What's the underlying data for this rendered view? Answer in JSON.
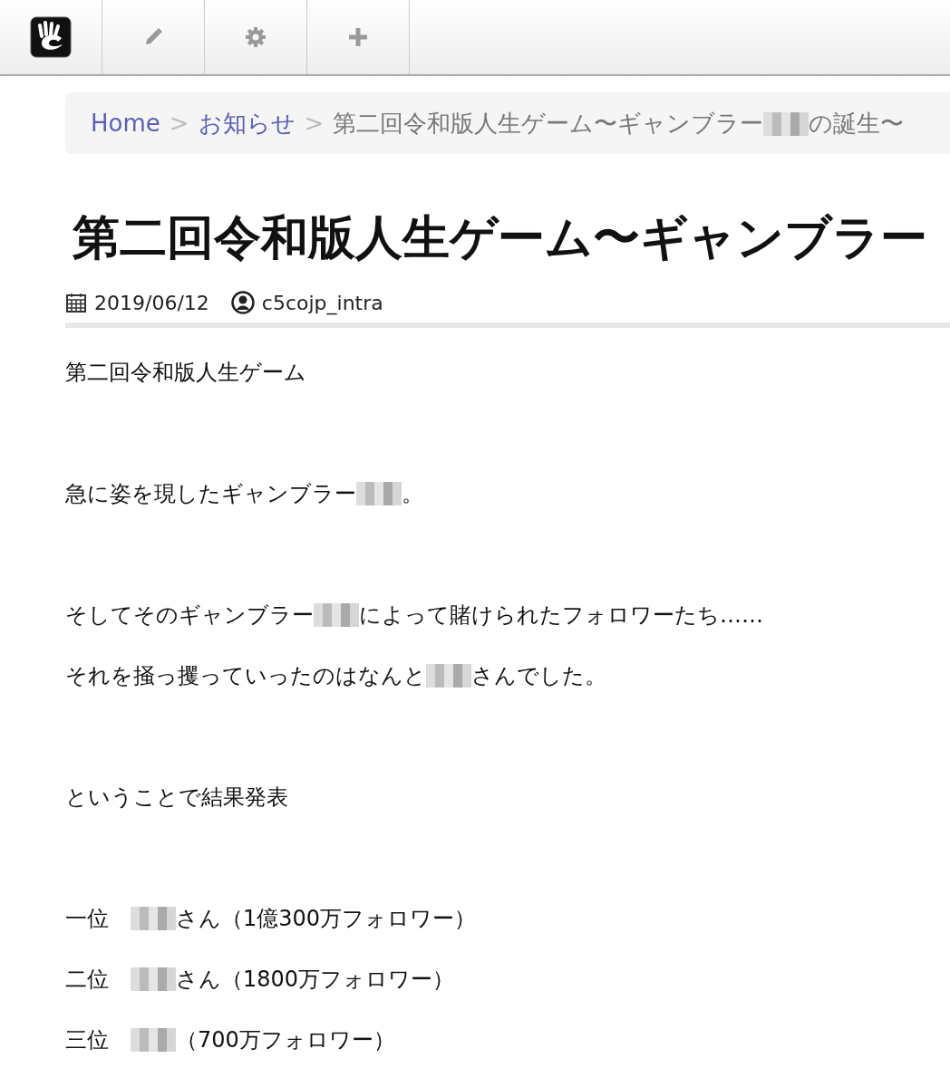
{
  "toolbar": {
    "buttons": [
      {
        "kind": "logo"
      },
      {
        "kind": "edit"
      },
      {
        "kind": "settings"
      },
      {
        "kind": "add"
      }
    ]
  },
  "breadcrumb": [
    {
      "kind": "link",
      "segments": [
        {
          "kind": "text",
          "text": "Home"
        }
      ]
    },
    {
      "kind": "separator",
      "segments": [
        {
          "kind": "text",
          "text": ">"
        }
      ]
    },
    {
      "kind": "link",
      "segments": [
        {
          "kind": "text",
          "text": "お知らせ"
        }
      ]
    },
    {
      "kind": "separator",
      "segments": [
        {
          "kind": "text",
          "text": ">"
        }
      ]
    },
    {
      "kind": "current",
      "segments": [
        {
          "kind": "text",
          "text": "第二回令和版人生ゲーム〜ギャンブラー"
        },
        {
          "kind": "redacted"
        },
        {
          "kind": "text",
          "text": "の誕生〜"
        }
      ]
    }
  ],
  "article": {
    "title": "第二回令和版人生ゲーム〜ギャンブラー",
    "date": "2019/06/12",
    "author": "c5cojp_intra",
    "paragraphs": [
      {
        "kind": "line",
        "segments": [
          {
            "kind": "text",
            "text": "第二回令和版人生ゲーム"
          }
        ]
      },
      {
        "kind": "blank"
      },
      {
        "kind": "line",
        "segments": [
          {
            "kind": "text",
            "text": "急に姿を現したギャンブラー"
          },
          {
            "kind": "redacted"
          },
          {
            "kind": "text",
            "text": "。"
          }
        ]
      },
      {
        "kind": "blank"
      },
      {
        "kind": "line",
        "segments": [
          {
            "kind": "text",
            "text": "そしてそのギャンブラー"
          },
          {
            "kind": "redacted"
          },
          {
            "kind": "text",
            "text": "によって賭けられたフォロワーたち……"
          }
        ]
      },
      {
        "kind": "line",
        "segments": [
          {
            "kind": "text",
            "text": "それを掻っ攫っていったのはなんと"
          },
          {
            "kind": "redacted"
          },
          {
            "kind": "text",
            "text": "さんでした。"
          }
        ]
      },
      {
        "kind": "blank"
      },
      {
        "kind": "line",
        "segments": [
          {
            "kind": "text",
            "text": "ということで結果発表"
          }
        ]
      },
      {
        "kind": "blank"
      },
      {
        "kind": "line",
        "segments": [
          {
            "kind": "text",
            "text": "一位　"
          },
          {
            "kind": "redacted"
          },
          {
            "kind": "text",
            "text": "さん（1億300万フォロワー）"
          }
        ]
      },
      {
        "kind": "line",
        "segments": [
          {
            "kind": "text",
            "text": "二位　"
          },
          {
            "kind": "redacted"
          },
          {
            "kind": "text",
            "text": "さん（1800万フォロワー）"
          }
        ]
      },
      {
        "kind": "line",
        "segments": [
          {
            "kind": "text",
            "text": "三位　"
          },
          {
            "kind": "redacted"
          },
          {
            "kind": "text",
            "text": "（700万フォロワー）"
          }
        ]
      }
    ]
  }
}
